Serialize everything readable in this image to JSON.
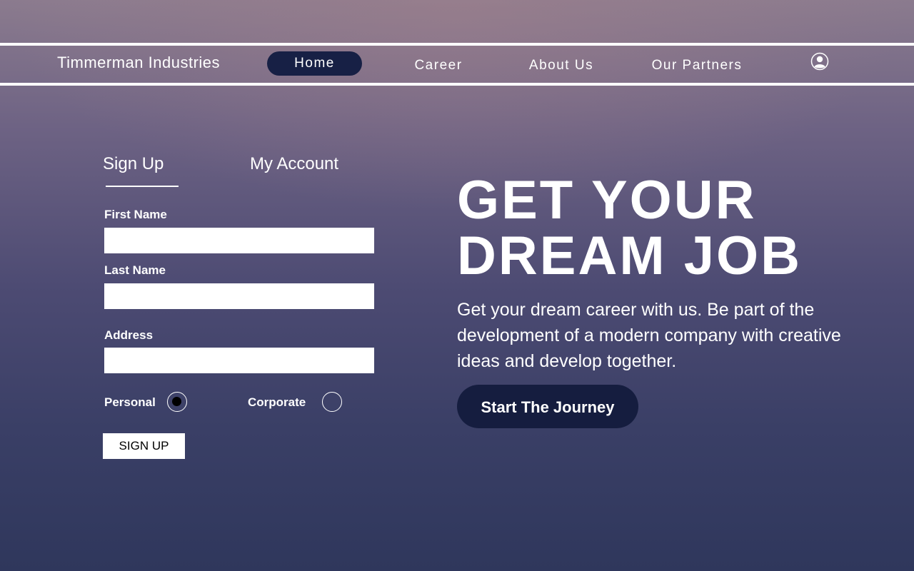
{
  "brand": {
    "name": "Timmerman Industries"
  },
  "nav": {
    "items": [
      {
        "label": "Home",
        "active": true
      },
      {
        "label": "Career",
        "active": false
      },
      {
        "label": "About Us",
        "active": false
      },
      {
        "label": "Our Partners",
        "active": false
      }
    ],
    "user_icon": "user-circle-icon"
  },
  "form": {
    "tabs": [
      {
        "label": "Sign Up",
        "active": true
      },
      {
        "label": "My Account",
        "active": false
      }
    ],
    "fields": {
      "first_name": {
        "label": "First Name",
        "value": "",
        "placeholder": ""
      },
      "last_name": {
        "label": "Last Name",
        "value": "",
        "placeholder": ""
      },
      "address": {
        "label": "Address",
        "value": "",
        "placeholder": ""
      }
    },
    "account_type": {
      "options": [
        {
          "label": "Personal",
          "selected": true
        },
        {
          "label": "Corporate",
          "selected": false
        }
      ]
    },
    "submit_label": "SIGN UP"
  },
  "hero": {
    "title_line1": "GET YOUR",
    "title_line2": "DREAM JOB",
    "text": "Get your dream career with us. Be part of the development of a modern company with creative ideas and develop together.",
    "cta_label": "Start The Journey"
  },
  "colors": {
    "nav_active_bg": "#172045",
    "cta_bg": "#151d3f",
    "line": "#ffffff"
  }
}
